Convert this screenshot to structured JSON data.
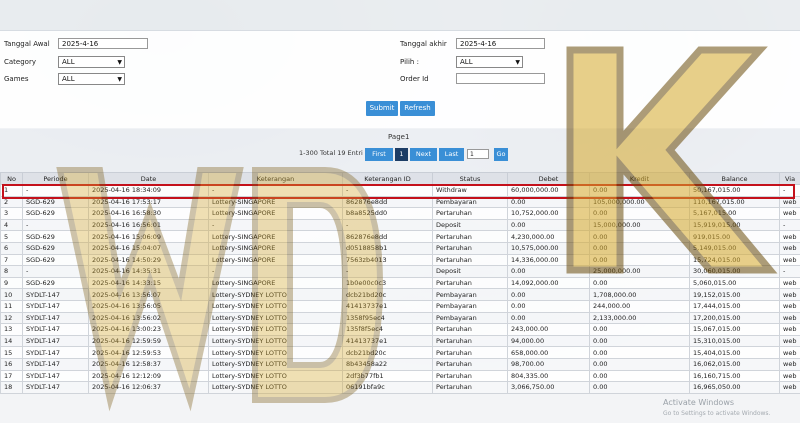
{
  "filters": {
    "tanggal_awal_label": "Tanggal Awal",
    "tanggal_awal_value": "2025-4-16",
    "category_label": "Category",
    "category_value": "ALL",
    "games_label": "Games",
    "games_value": "ALL",
    "tanggal_akhir_label": "Tanggal akhir",
    "tanggal_akhir_value": "2025-4-16",
    "pilih_label": "Pilih :",
    "pilih_value": "ALL",
    "order_id_label": "Order Id",
    "order_id_value": ""
  },
  "buttons": {
    "submit": "Submit",
    "refresh": "Refresh"
  },
  "pager": {
    "title": "Page1",
    "total": "1-300 Total 19 Entri",
    "first": "First",
    "current": "1",
    "next": "Next",
    "last": "Last",
    "page_input": "1",
    "go": "Go"
  },
  "table": {
    "headers": [
      "No",
      "Periode",
      "Date",
      "Keterangan",
      "Keterangan ID",
      "Status",
      "Debet",
      "Kredit",
      "Balance",
      "Via"
    ],
    "rows": [
      [
        "1",
        "-",
        "2025-04-16 18:34:09",
        "-",
        "-",
        "Withdraw",
        "60,000,000.00",
        "0.00",
        "50,167,015.00",
        "-"
      ],
      [
        "2",
        "SGD-629",
        "2025-04-16 17:53:17",
        "Lottery-SINGAPORE",
        "862876e8dd",
        "Pembayaran",
        "0.00",
        "105,000,000.00",
        "110,167,015.00",
        "web"
      ],
      [
        "3",
        "SGD-629",
        "2025-04-16 16:58:30",
        "Lottery-SINGAPORE",
        "b8a8525dd0",
        "Pertaruhan",
        "10,752,000.00",
        "0.00",
        "5,167,015.00",
        "web"
      ],
      [
        "4",
        "-",
        "2025-04-16 16:56:01",
        "-",
        "-",
        "Deposit",
        "0.00",
        "15,000,000.00",
        "15,919,015.00",
        "-"
      ],
      [
        "5",
        "SGD-629",
        "2025-04-16 15:06:09",
        "Lottery-SINGAPORE",
        "862876e8dd",
        "Pertaruhan",
        "4,230,000.00",
        "0.00",
        "919,015.00",
        "web"
      ],
      [
        "6",
        "SGD-629",
        "2025-04-16 15:04:07",
        "Lottery-SINGAPORE",
        "d0518858b1",
        "Pertaruhan",
        "10,575,000.00",
        "0.00",
        "5,149,015.00",
        "web"
      ],
      [
        "7",
        "SGD-629",
        "2025-04-16 14:50:29",
        "Lottery-SINGAPORE",
        "7563zb4013",
        "Pertaruhan",
        "14,336,000.00",
        "0.00",
        "15,724,015.00",
        "web"
      ],
      [
        "8",
        "-",
        "2025-04-16 14:35:31",
        "-",
        "-",
        "Deposit",
        "0.00",
        "25,000,000.00",
        "30,060,015.00",
        "-"
      ],
      [
        "9",
        "SGD-629",
        "2025-04-16 14:33:15",
        "Lottery-SINGAPORE",
        "1b0e00c0c3",
        "Pertaruhan",
        "14,092,000.00",
        "0.00",
        "5,060,015.00",
        "web"
      ],
      [
        "10",
        "SYDLT-147",
        "2025-04-16 13:56:07",
        "Lottery-SYDNEY LOTTO",
        "dcb21bd20c",
        "Pembayaran",
        "0.00",
        "1,708,000.00",
        "19,152,015.00",
        "web"
      ],
      [
        "11",
        "SYDLT-147",
        "2025-04-16 13:56:05",
        "Lottery-SYDNEY LOTTO",
        "41413737e1",
        "Pembayaran",
        "0.00",
        "244,000.00",
        "17,444,015.00",
        "web"
      ],
      [
        "12",
        "SYDLT-147",
        "2025-04-16 13:56:02",
        "Lottery-SYDNEY LOTTO",
        "1358f95ec4",
        "Pembayaran",
        "0.00",
        "2,133,000.00",
        "17,200,015.00",
        "web"
      ],
      [
        "13",
        "SYDLT-147",
        "2025-04-16 13:00:23",
        "Lottery-SYDNEY LOTTO",
        "135f8f5ec4",
        "Pertaruhan",
        "243,000.00",
        "0.00",
        "15,067,015.00",
        "web"
      ],
      [
        "14",
        "SYDLT-147",
        "2025-04-16 12:59:59",
        "Lottery-SYDNEY LOTTO",
        "41413737e1",
        "Pertaruhan",
        "94,000.00",
        "0.00",
        "15,310,015.00",
        "web"
      ],
      [
        "15",
        "SYDLT-147",
        "2025-04-16 12:59:53",
        "Lottery-SYDNEY LOTTO",
        "dcb21bd20c",
        "Pertaruhan",
        "658,000.00",
        "0.00",
        "15,404,015.00",
        "web"
      ],
      [
        "16",
        "SYDLT-147",
        "2025-04-16 12:58:37",
        "Lottery-SYDNEY LOTTO",
        "8b43458a22",
        "Pertaruhan",
        "98,700.00",
        "0.00",
        "16,062,015.00",
        "web"
      ],
      [
        "17",
        "SYDLT-147",
        "2025-04-16 12:12:09",
        "Lottery-SYDNEY LOTTO",
        "2df3b77fb1",
        "Pertaruhan",
        "804,335.00",
        "0.00",
        "16,160,715.00",
        "web"
      ],
      [
        "18",
        "SYDLT-147",
        "2025-04-16 12:06:37",
        "Lottery-SYDNEY LOTTO",
        "06191bfa9c",
        "Pertaruhan",
        "3,066,750.00",
        "0.00",
        "16,965,050.00",
        "web"
      ]
    ]
  },
  "colors": {
    "button_blue": "#3a8fd6",
    "highlight_red": "#c4101b",
    "debit_red": "#d20000",
    "credit_green": "#0b8c1b",
    "link_blue": "#2f7fd1",
    "watermark_gold": "#d6a92a"
  },
  "watermark": {
    "text": "WDKUK"
  },
  "os_notice": {
    "line1": "Activate Windows",
    "line2": "Go to Settings to activate Windows."
  }
}
